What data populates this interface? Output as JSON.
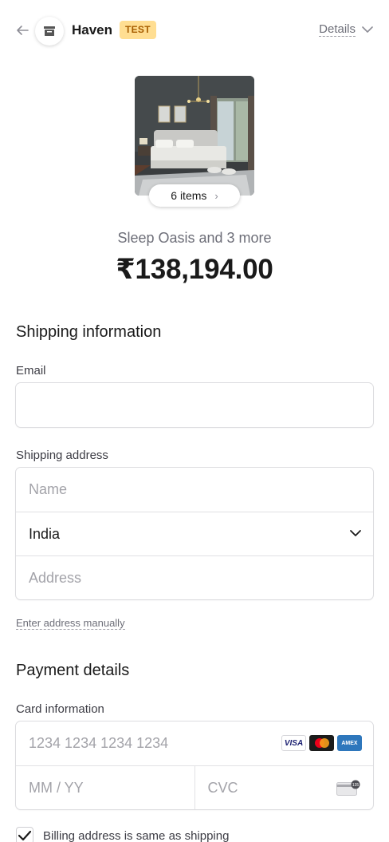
{
  "header": {
    "store_name": "Haven",
    "badge": "TEST",
    "details_label": "Details"
  },
  "product": {
    "items_label": "6 items",
    "summary": "Sleep Oasis and 3 more",
    "total": "₹138,194.00"
  },
  "shipping": {
    "title": "Shipping information",
    "email_label": "Email",
    "email_value": "",
    "address_label": "Shipping address",
    "name_placeholder": "Name",
    "country_value": "India",
    "address_placeholder": "Address",
    "manual_link": "Enter address manually"
  },
  "payment": {
    "title": "Payment details",
    "card_label": "Card information",
    "card_placeholder": "1234 1234 1234 1234",
    "expiry_placeholder": "MM / YY",
    "cvc_placeholder": "CVC",
    "brands": [
      "VISA",
      "Mastercard",
      "AMEX"
    ],
    "billing_same_label": "Billing address is same as shipping",
    "billing_same_checked": true
  },
  "colors": {
    "badge_bg": "#ffde92",
    "badge_text": "#a65c00",
    "muted_text": "#6d6e78",
    "border": "#dcdcdf"
  }
}
